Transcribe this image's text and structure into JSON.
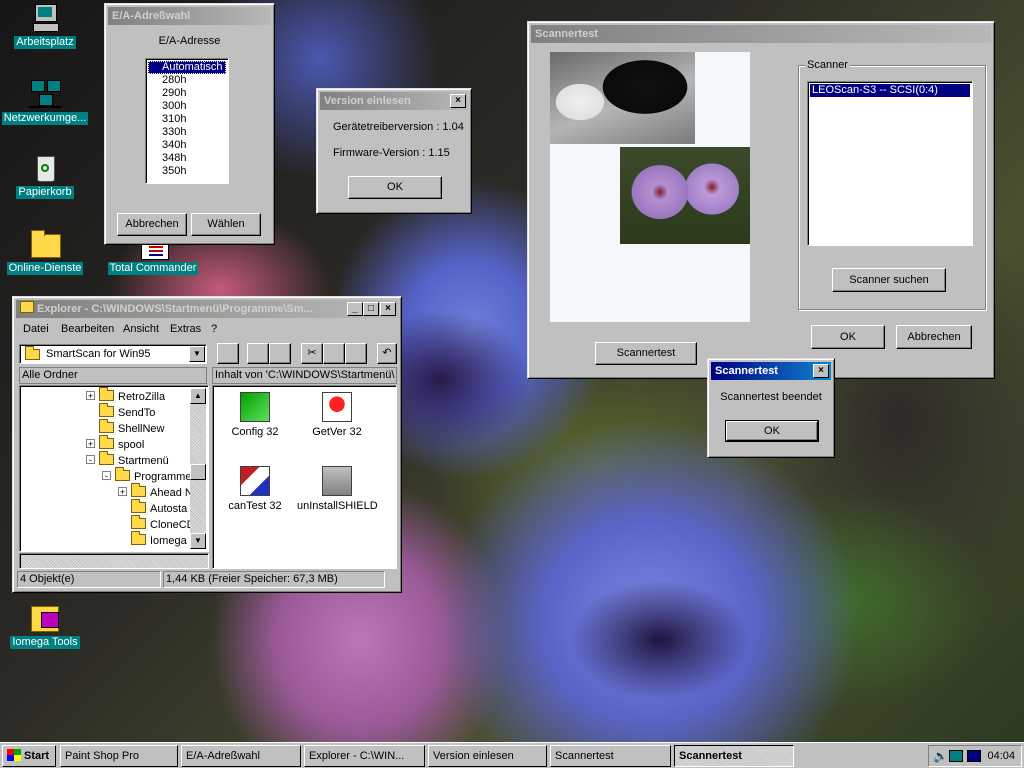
{
  "desktop": {
    "icons": [
      {
        "label": "Arbeitsplatz",
        "icon": "my-computer-icon"
      },
      {
        "label": "Netzwerkumge...",
        "icon": "network-icon"
      },
      {
        "label": "Papierkorb",
        "icon": "recycle-bin-icon"
      },
      {
        "label": "Online-Dienste",
        "icon": "folder-icon"
      },
      {
        "label": "Total Commander",
        "icon": "total-commander-icon"
      },
      {
        "label": "Iomega Tools",
        "icon": "iomega-tools-icon"
      }
    ]
  },
  "ea_dialog": {
    "title": "E/A-Adreßwahl",
    "heading": "E/A-Adresse",
    "options": [
      "Automatisch",
      "280h",
      "290h",
      "300h",
      "310h",
      "330h",
      "340h",
      "348h",
      "350h"
    ],
    "selected": "Automatisch",
    "cancel_label": "Abbrechen",
    "select_label": "Wählen"
  },
  "version_dialog": {
    "title": "Version einlesen",
    "driver_version": "Gerätetreiberversion : 1.04",
    "firmware_version": "Firmware-Version : 1.15",
    "ok_label": "OK"
  },
  "scanner_window": {
    "title": "Scannertest",
    "group_label": "Scanner",
    "scanner_entry": "LEOScan-S3  -- SCSI(0:4)",
    "search_label": "Scanner suchen",
    "ok_label": "OK",
    "cancel_label": "Abbrechen",
    "scantest_label": "Scannertest"
  },
  "scannertest_done": {
    "title": "Scannertest",
    "message": "Scannertest beendet",
    "ok_label": "OK"
  },
  "explorer": {
    "title": "Explorer - C:\\WINDOWS\\Startmenü\\Programme\\Sm...",
    "menu": [
      "Datei",
      "Bearbeiten",
      "Ansicht",
      "Extras",
      "?"
    ],
    "address": "SmartScan for Win95",
    "all_folders_label": "Alle Ordner",
    "content_header": "Inhalt von 'C:\\WINDOWS\\Startmenü\\",
    "tree": [
      {
        "label": "RetroZilla",
        "expander": "+"
      },
      {
        "label": "SendTo",
        "expander": ""
      },
      {
        "label": "ShellNew",
        "expander": ""
      },
      {
        "label": "spool",
        "expander": "+"
      },
      {
        "label": "Startmenü",
        "expander": "-"
      },
      {
        "label": "Programme",
        "expander": "-"
      },
      {
        "label": "Ahead N",
        "expander": "+"
      },
      {
        "label": "Autosta",
        "expander": ""
      },
      {
        "label": "CloneCD",
        "expander": ""
      },
      {
        "label": "Iomega",
        "expander": ""
      }
    ],
    "files": [
      {
        "label": "Config 32",
        "icon": "config-icon"
      },
      {
        "label": "GetVer 32",
        "icon": "info-icon"
      },
      {
        "label": "canTest 32",
        "icon": "scantest-icon"
      },
      {
        "label": "unInstallSHIELD",
        "icon": "uninstall-icon"
      }
    ],
    "status_count": "4 Objekt(e)",
    "status_size": "1,44 KB (Freier Speicher: 67,3 MB)"
  },
  "taskbar": {
    "start_label": "Start",
    "buttons": [
      "Paint Shop Pro",
      "E/A-Adreßwahl",
      "Explorer - C:\\WIN...",
      "Version einlesen",
      "Scannertest",
      "Scannertest"
    ],
    "active_index": 5,
    "clock": "04:04"
  }
}
